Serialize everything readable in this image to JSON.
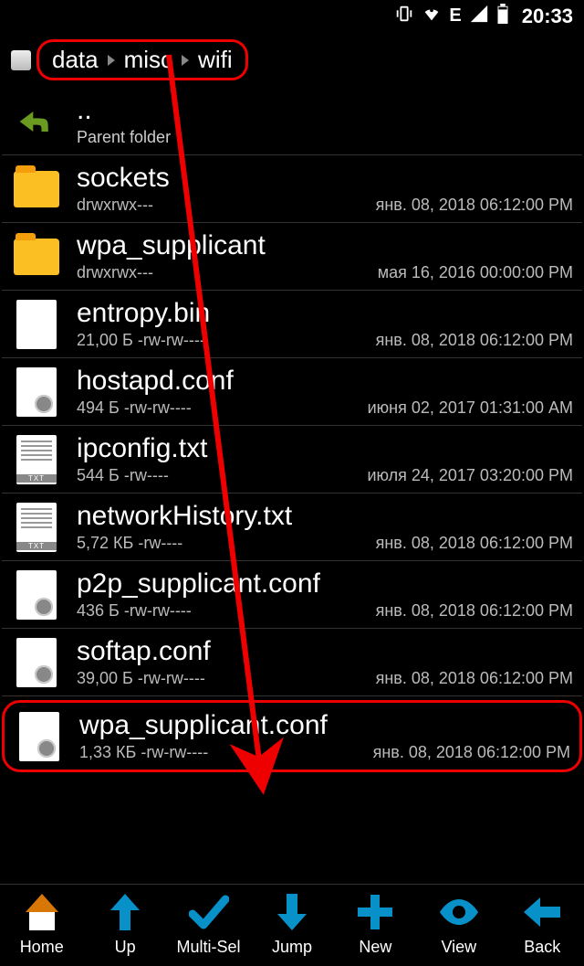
{
  "status": {
    "time": "20:33",
    "network": "E"
  },
  "breadcrumb": {
    "items": [
      "data",
      "misc",
      "wifi"
    ]
  },
  "parent": {
    "dots": "..",
    "label": "Parent folder"
  },
  "files": [
    {
      "name": "sockets",
      "perms": "drwxrwx---",
      "date": "янв. 08, 2018 06:12:00 PM",
      "type": "folder"
    },
    {
      "name": "wpa_supplicant",
      "perms": "drwxrwx---",
      "date": "мая 16, 2016 00:00:00 PM",
      "type": "folder"
    },
    {
      "name": "entropy.bin",
      "perms": "21,00 Б -rw-rw----",
      "date": "янв. 08, 2018 06:12:00 PM",
      "type": "file"
    },
    {
      "name": "hostapd.conf",
      "perms": "494 Б -rw-rw----",
      "date": "июня 02, 2017 01:31:00 AM",
      "type": "gear"
    },
    {
      "name": "ipconfig.txt",
      "perms": "544 Б -rw----",
      "date": "июля 24, 2017 03:20:00 PM",
      "type": "txt"
    },
    {
      "name": "networkHistory.txt",
      "perms": "5,72 КБ -rw----",
      "date": "янв. 08, 2018 06:12:00 PM",
      "type": "txt"
    },
    {
      "name": "p2p_supplicant.conf",
      "perms": "436 Б -rw-rw----",
      "date": "янв. 08, 2018 06:12:00 PM",
      "type": "gear"
    },
    {
      "name": "softap.conf",
      "perms": "39,00 Б -rw-rw----",
      "date": "янв. 08, 2018 06:12:00 PM",
      "type": "gear"
    },
    {
      "name": "wpa_supplicant.conf",
      "perms": "1,33 КБ -rw-rw----",
      "date": "янв. 08, 2018 06:12:00 PM",
      "type": "gear",
      "highlight": true
    }
  ],
  "toolbar": {
    "home": "Home",
    "up": "Up",
    "multisel": "Multi-Sel",
    "jump": "Jump",
    "new": "New",
    "view": "View",
    "back": "Back"
  }
}
